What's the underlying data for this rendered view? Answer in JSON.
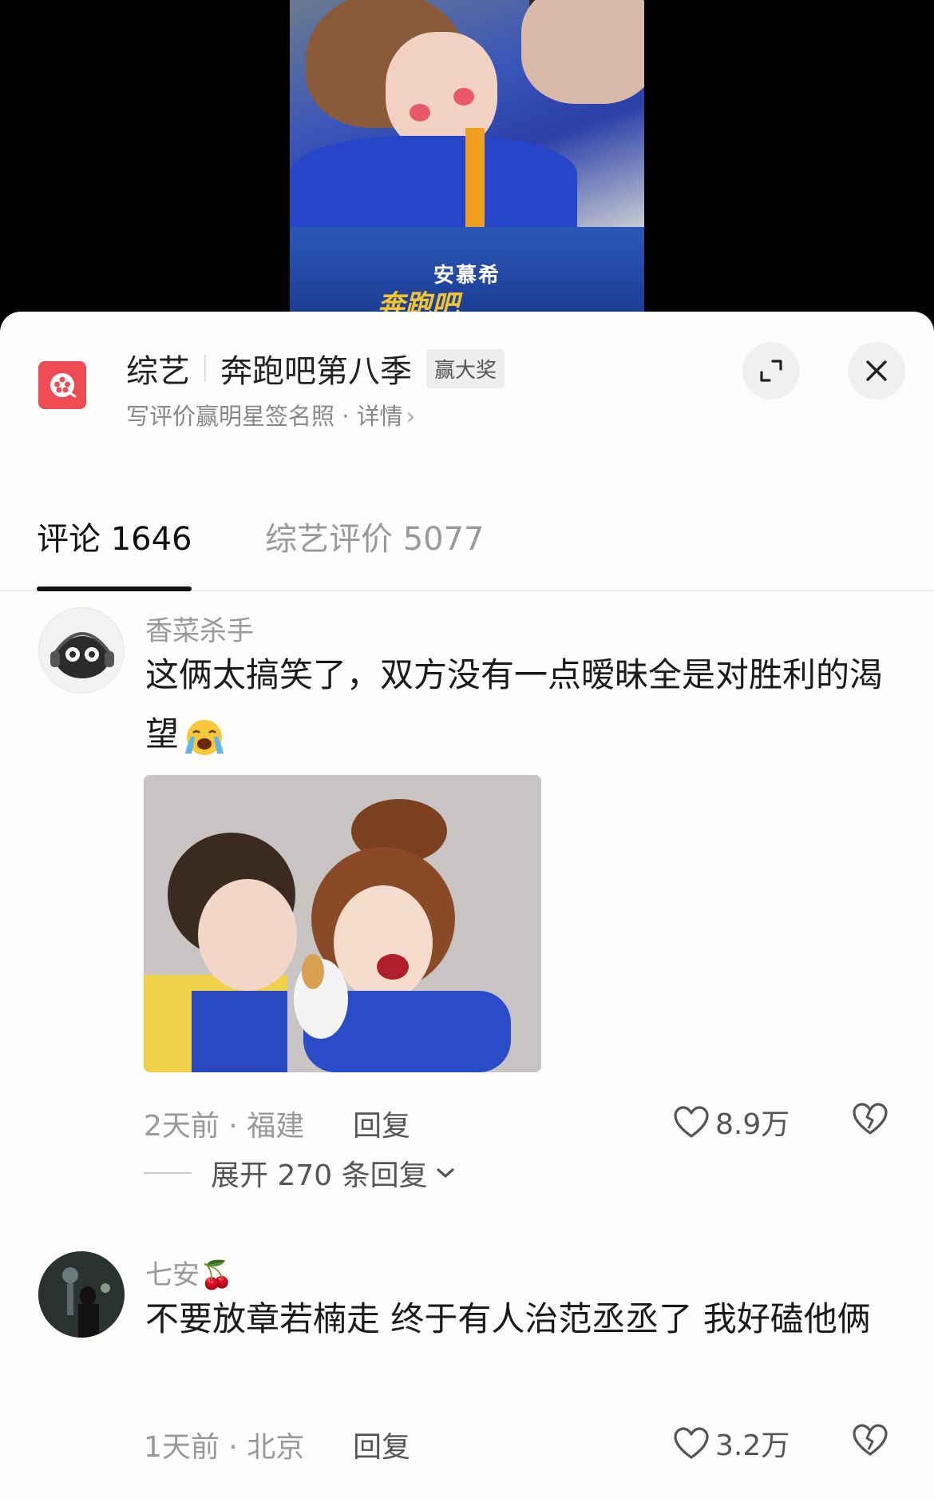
{
  "video": {
    "logo_text": "安慕希",
    "logo_sub": "奔跑吧"
  },
  "header": {
    "category": "综艺",
    "show_title": "奔跑吧第八季",
    "badge": "赢大奖",
    "subtitle": "写评价赢明星签名照 · 详情",
    "subtitle_arrow": "›"
  },
  "tabs": [
    {
      "label": "评论 1646",
      "active": true
    },
    {
      "label": "综艺评价 5077",
      "active": false
    }
  ],
  "comments": [
    {
      "username": "香菜杀手",
      "text": "这俩太搞笑了，双方没有一点暧昧全是对胜利的渴望",
      "time_location": "2天前 · 福建",
      "reply_label": "回复",
      "likes": "8.9万",
      "expand_label": "展开 270 条回复",
      "has_image": true
    },
    {
      "username": "七安🍒",
      "text": "不要放章若楠走 终于有人治范丞丞了 我好磕他俩",
      "time_location": "1天前 · 北京",
      "reply_label": "回复",
      "likes": "3.2万"
    }
  ],
  "colors": {
    "app_icon": "#ee4b55",
    "panel_bg": "#fdfdfb",
    "muted_text": "#999999"
  }
}
